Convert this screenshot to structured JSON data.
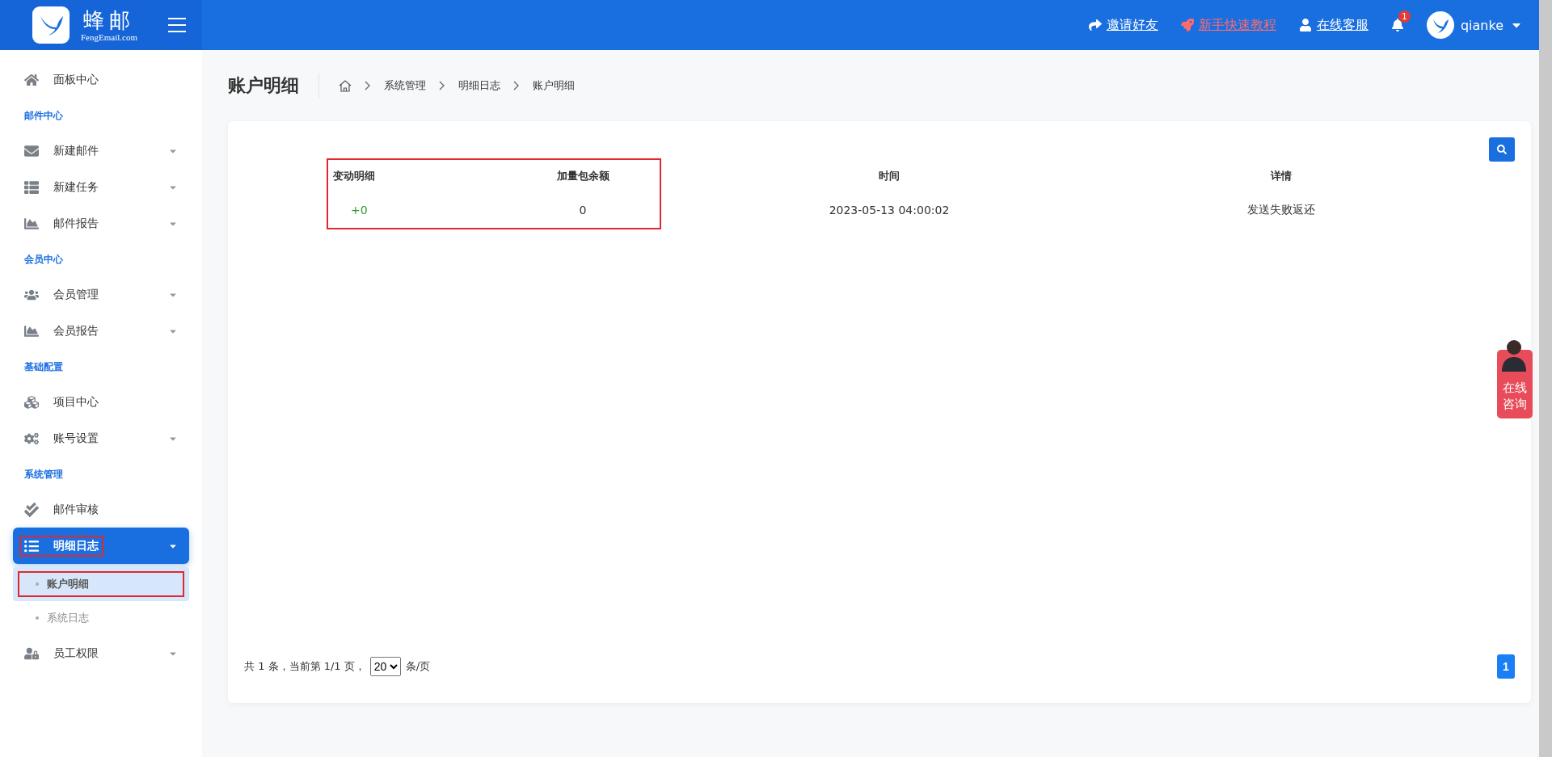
{
  "header": {
    "logo_title": "蜂邮",
    "logo_subtitle": "FengEmail.com",
    "links": [
      {
        "label": "邀请好友",
        "kind": "plain"
      },
      {
        "label": "新手快速教程",
        "kind": "highlight"
      },
      {
        "label": "在线客服",
        "kind": "plain"
      }
    ],
    "notification_count": "1",
    "username": "qianke"
  },
  "sidebar": {
    "items": [
      {
        "kind": "item",
        "label": "面板中心",
        "expandable": false,
        "selected": false,
        "outlined": false
      },
      {
        "kind": "section",
        "label": "邮件中心"
      },
      {
        "kind": "item",
        "label": "新建邮件",
        "expandable": true,
        "selected": false,
        "outlined": false
      },
      {
        "kind": "item",
        "label": "新建任务",
        "expandable": true,
        "selected": false,
        "outlined": false
      },
      {
        "kind": "item",
        "label": "邮件报告",
        "expandable": true,
        "selected": false,
        "outlined": false
      },
      {
        "kind": "section",
        "label": "会员中心"
      },
      {
        "kind": "item",
        "label": "会员管理",
        "expandable": true,
        "selected": false,
        "outlined": false
      },
      {
        "kind": "item",
        "label": "会员报告",
        "expandable": true,
        "selected": false,
        "outlined": false
      },
      {
        "kind": "section",
        "label": "基础配置"
      },
      {
        "kind": "item",
        "label": "项目中心",
        "expandable": false,
        "selected": false,
        "outlined": false
      },
      {
        "kind": "item",
        "label": "账号设置",
        "expandable": true,
        "selected": false,
        "outlined": false
      },
      {
        "kind": "section",
        "label": "系统管理"
      },
      {
        "kind": "item",
        "label": "邮件审核",
        "expandable": false,
        "selected": false,
        "outlined": false
      },
      {
        "kind": "item",
        "label": "明细日志",
        "expandable": true,
        "selected": true,
        "outlined": true,
        "children": [
          {
            "label": "账户明细",
            "selected": true,
            "outlined": true
          },
          {
            "label": "系统日志",
            "selected": false,
            "outlined": false
          }
        ]
      },
      {
        "kind": "item",
        "label": "员工权限",
        "expandable": true,
        "selected": false,
        "outlined": false
      }
    ]
  },
  "page_title": "账户明细",
  "breadcrumb": [
    "系统管理",
    "明细日志",
    "账户明细"
  ],
  "table": {
    "columns": [
      {
        "header": "变动明细",
        "outlined": true
      },
      {
        "header": "加量包余额",
        "outlined": true
      },
      {
        "header": "时间",
        "outlined": false
      },
      {
        "header": "详情",
        "outlined": false
      }
    ],
    "rows": [
      {
        "cells": [
          "+0",
          "0",
          "2023-05-13 04:00:02",
          "发送失败返还"
        ]
      }
    ]
  },
  "pagination": {
    "summary": "共 1 条，当前第 1/1 页，",
    "page_size": "20",
    "page_size_unit": "条/页",
    "pages": [
      {
        "label": "1",
        "selected": true
      }
    ]
  },
  "consult_widget": {
    "label": "在线咨询"
  }
}
